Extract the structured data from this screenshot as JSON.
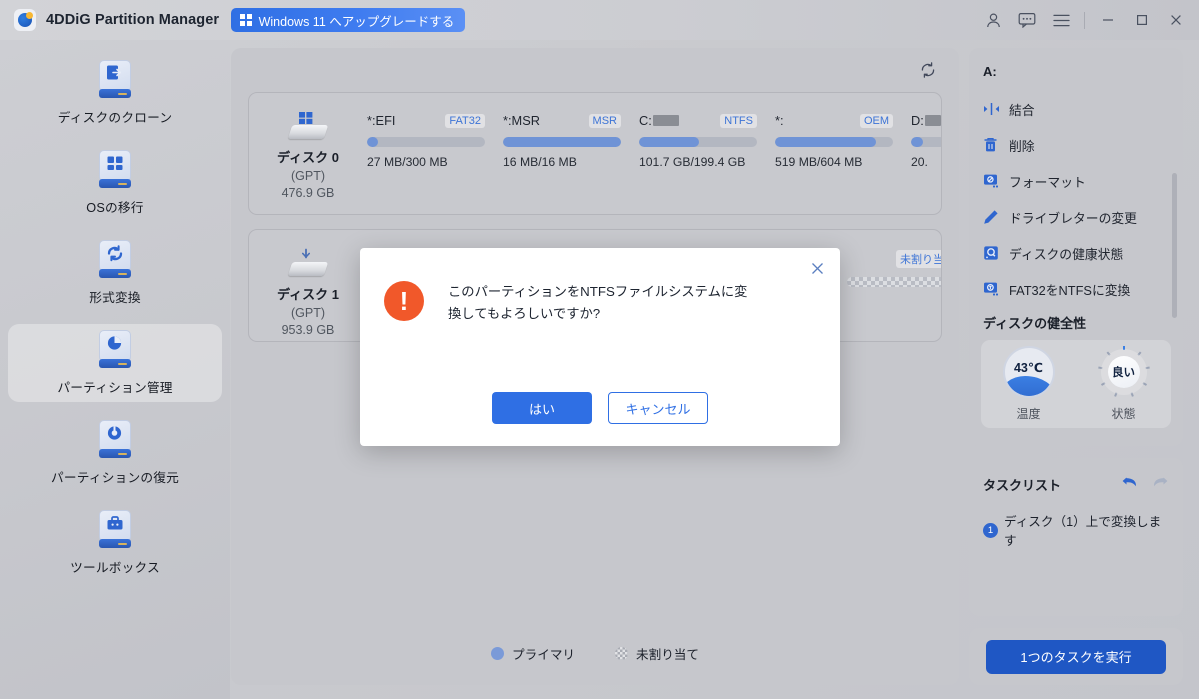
{
  "titlebar": {
    "app_title": "4DDiG Partition Manager",
    "upgrade_label": "Windows 11 へアップグレードする",
    "icons": [
      "account-icon",
      "feedback-icon",
      "menu-icon",
      "minimize-icon",
      "maximize-icon",
      "close-icon"
    ]
  },
  "sidebar": {
    "items": [
      {
        "label": "ディスクのクローン",
        "icon": "disk-clone-icon",
        "active": false
      },
      {
        "label": "OSの移行",
        "icon": "os-migrate-icon",
        "active": false
      },
      {
        "label": "形式変換",
        "icon": "format-convert-icon",
        "active": false
      },
      {
        "label": "パーティション管理",
        "icon": "partition-manage-icon",
        "active": true
      },
      {
        "label": "パーティションの復元",
        "icon": "partition-recover-icon",
        "active": false
      },
      {
        "label": "ツールボックス",
        "icon": "toolbox-icon",
        "active": false
      }
    ]
  },
  "main": {
    "refresh_icon": "refresh-icon",
    "disks": [
      {
        "name": "ディスク 0",
        "type": "(GPT)",
        "size": "476.9 GB",
        "partitions": [
          {
            "label": "*:EFI",
            "redacted": false,
            "fs": "FAT32",
            "size": "27 MB/300 MB",
            "fill_pct": 9,
            "width": 118,
            "unallocated": false
          },
          {
            "label": "*:MSR",
            "redacted": false,
            "fs": "MSR",
            "size": "16 MB/16 MB",
            "fill_pct": 100,
            "width": 118,
            "unallocated": false
          },
          {
            "label": "C:",
            "redacted": true,
            "fs": "NTFS",
            "size": "101.7 GB/199.4 GB",
            "fill_pct": 51,
            "width": 118,
            "unallocated": false
          },
          {
            "label": "*:",
            "redacted": false,
            "fs": "OEM",
            "size": "519 MB/604 MB",
            "fill_pct": 86,
            "width": 118,
            "unallocated": false
          },
          {
            "label": "D:",
            "redacted": true,
            "fs": "",
            "size": "20.",
            "fill_pct": 12,
            "width": 30,
            "unallocated": false
          }
        ]
      },
      {
        "name": "ディスク 1",
        "type": "(GPT)",
        "size": "953.9 GB",
        "partitions": [
          {
            "label": "",
            "redacted": false,
            "fs": "未割り当て",
            "size": "",
            "fill_pct": 0,
            "width": 108,
            "unallocated": true
          }
        ]
      }
    ],
    "legend": [
      {
        "label": "プライマリ",
        "swatch": "primary"
      },
      {
        "label": "未割り当て",
        "swatch": "unallocated"
      }
    ]
  },
  "rightbar": {
    "drive_label": "A:",
    "actions": [
      {
        "label": "結合",
        "icon": "merge-icon"
      },
      {
        "label": "削除",
        "icon": "trash-icon"
      },
      {
        "label": "フォーマット",
        "icon": "format-disk-icon"
      },
      {
        "label": "ドライブレターの変更",
        "icon": "pencil-icon"
      },
      {
        "label": "ディスクの健康状態",
        "icon": "disk-health-icon"
      },
      {
        "label": "FAT32をNTFSに変換",
        "icon": "convert-disk-icon"
      }
    ],
    "health": {
      "title": "ディスクの健全性",
      "temperature_value": "43℃",
      "temperature_caption": "温度",
      "state_value": "良い",
      "state_caption": "状態"
    },
    "tasks": {
      "title": "タスクリスト",
      "undo_icon": "undo-icon",
      "redo_icon": "redo-icon",
      "items": [
        {
          "num": "1",
          "label": "ディスク（1）上で変換します"
        }
      ]
    },
    "execute_label": "1つのタスクを実行"
  },
  "modal": {
    "close_icon": "close-icon",
    "alert_icon": "alert-exclamation-icon",
    "message": "このパーティションをNTFSファイルシステムに変換してもよろしいですか?",
    "confirm_label": "はい",
    "cancel_label": "キャンセル"
  },
  "colors": {
    "accent": "#2f6fe4",
    "accent_dark": "#1f57c4",
    "alert": "#f1582a",
    "bar_fill": "#6f93d6",
    "bar_track": "#b3b7c1",
    "panel": "#c6c7cc"
  }
}
